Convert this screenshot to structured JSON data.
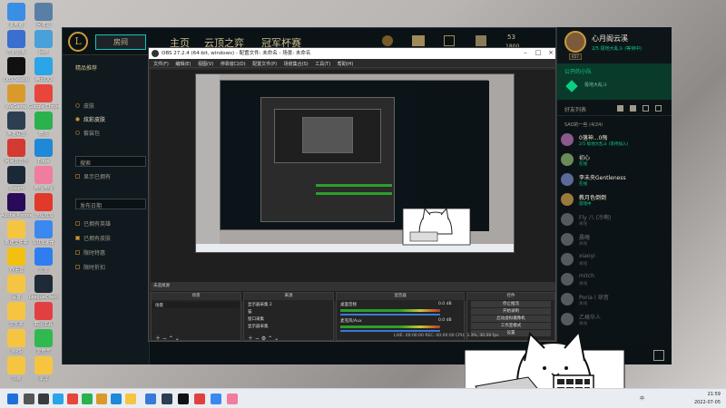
{
  "desktop": {
    "icons": [
      {
        "label": "此电脑",
        "color": "#3a8ee6"
      },
      {
        "label": "回收站",
        "color": "#5a7fa5"
      },
      {
        "label": "控制面板",
        "color": "#3a6fcf"
      },
      {
        "label": "网络",
        "color": "#4aa0d8"
      },
      {
        "label": "OBS Studio",
        "color": "#111111"
      },
      {
        "label": "腾讯QQ",
        "color": "#2aa5e8"
      },
      {
        "label": "WeGame",
        "color": "#d99a2b"
      },
      {
        "label": "Google Chrome",
        "color": "#e8463a"
      },
      {
        "label": "英雄联盟",
        "color": "#2c3e50"
      },
      {
        "label": "微信",
        "color": "#2bb24c"
      },
      {
        "label": "网易云音乐",
        "color": "#d33a31"
      },
      {
        "label": "Edge",
        "color": "#1f88d8"
      },
      {
        "label": "Steam",
        "color": "#1b2838"
      },
      {
        "label": "哔哩哔哩",
        "color": "#f07ca0"
      },
      {
        "label": "Adobe Premiere",
        "color": "#2a0b5a"
      },
      {
        "label": "游戏加加",
        "color": "#e1392b"
      },
      {
        "label": "新建文件夹",
        "color": "#f5c542"
      },
      {
        "label": "UU加速器",
        "color": "#3a88f0"
      },
      {
        "label": "YY语音",
        "color": "#f2c10f"
      },
      {
        "label": "迅雷",
        "color": "#2e7ef0"
      },
      {
        "label": "设置",
        "color": "#f5c542"
      },
      {
        "label": "LeagueClient",
        "color": "#1e2a36"
      },
      {
        "label": "文件夹",
        "color": "#f5c542"
      },
      {
        "label": "截图工具",
        "color": "#e24040"
      },
      {
        "label": "WPS",
        "color": "#f5c542"
      },
      {
        "label": "爱奇艺",
        "color": "#2fb950"
      },
      {
        "label": "项目",
        "color": "#f5c542"
      },
      {
        "label": "录屏",
        "color": "#f5c542"
      }
    ]
  },
  "lol": {
    "logo": "L",
    "play_button": "房间",
    "nav": [
      "主页",
      "云顶之弈",
      "冠军杯赛"
    ],
    "currency_rp": "53",
    "currency_be": "1800",
    "left": {
      "header": "精品推荐",
      "tabs": [
        "皮肤",
        "炫彩皮肤",
        "套装包"
      ],
      "search_placeholder": "搜索",
      "show_owned": "显示已拥有",
      "sort_label": "发布日期",
      "filters": [
        "已拥有英雄",
        "已拥有皮肤",
        "限时特惠",
        "限时折扣"
      ]
    }
  },
  "friends": {
    "me": {
      "name": "心月阁云溪",
      "status": "2/5 极地大乱斗 (等待中)",
      "level": "657"
    },
    "party": {
      "label": "公开的小队",
      "sub": "极地大乱斗"
    },
    "section": "好友列表",
    "group": "SAO的一些 (4/24)",
    "list": [
      {
        "name": "0落神...0殇",
        "status": "2/5 极地大乱斗 (等待加入)",
        "online": true,
        "color": "#8a5a8a"
      },
      {
        "name": "初心",
        "status": "在线",
        "online": true,
        "color": "#6a8a5a"
      },
      {
        "name": "李未央Gentleness",
        "status": "在线",
        "online": true,
        "color": "#5a6a9a"
      },
      {
        "name": "教月色倒倒",
        "status": "游戏中",
        "online": true,
        "color": "#9a7a3a"
      },
      {
        "name": "Fly 八 (冷啊)",
        "status": "离线",
        "online": false,
        "color": "#555a60"
      },
      {
        "name": "晨曦",
        "status": "离线",
        "online": false,
        "color": "#555a60"
      },
      {
        "name": "xiaoyi",
        "status": "离线",
        "online": false,
        "color": "#555a60"
      },
      {
        "name": "mitch",
        "status": "离线",
        "online": false,
        "color": "#555a60"
      },
      {
        "name": "Poria丨琼音",
        "status": "离线",
        "online": false,
        "color": "#555a60"
      },
      {
        "name": "乙格华人",
        "status": "离线",
        "online": false,
        "color": "#555a60"
      }
    ]
  },
  "obs": {
    "title": "OBS 27.2.4 (64-bit, windows) - 配置文件: 未命名 - 场景: 未命名",
    "menu": [
      "文件(F)",
      "编辑(E)",
      "视图(V)",
      "停靠窗口(D)",
      "配置文件(P)",
      "场景集合(S)",
      "工具(T)",
      "帮助(H)"
    ],
    "status_line": "未选择源",
    "docks": {
      "scenes": {
        "title": "场景",
        "items": [
          "场景"
        ]
      },
      "sources": {
        "title": "来源",
        "items": [
          "显示器采集 2",
          "猫",
          "窗口采集",
          "显示器采集"
        ]
      },
      "mixer": {
        "title": "混音器",
        "tracks": [
          {
            "name": "桌面音频",
            "db": "0.0 dB"
          },
          {
            "name": "麦克风/Aux",
            "db": "0.0 dB"
          }
        ]
      },
      "controls": {
        "title": "控件",
        "buttons": [
          "停止推流",
          "开始录制",
          "启动虚拟摄像机",
          "工作室模式",
          "设置",
          "退出"
        ]
      }
    },
    "footer": "LIVE: 00:00:00   REC: 00:00:00   CPU: 3.3%, 30.00 fps"
  },
  "taskbar": {
    "time": "21:59",
    "date": "2022-07-05",
    "lang": "中"
  }
}
